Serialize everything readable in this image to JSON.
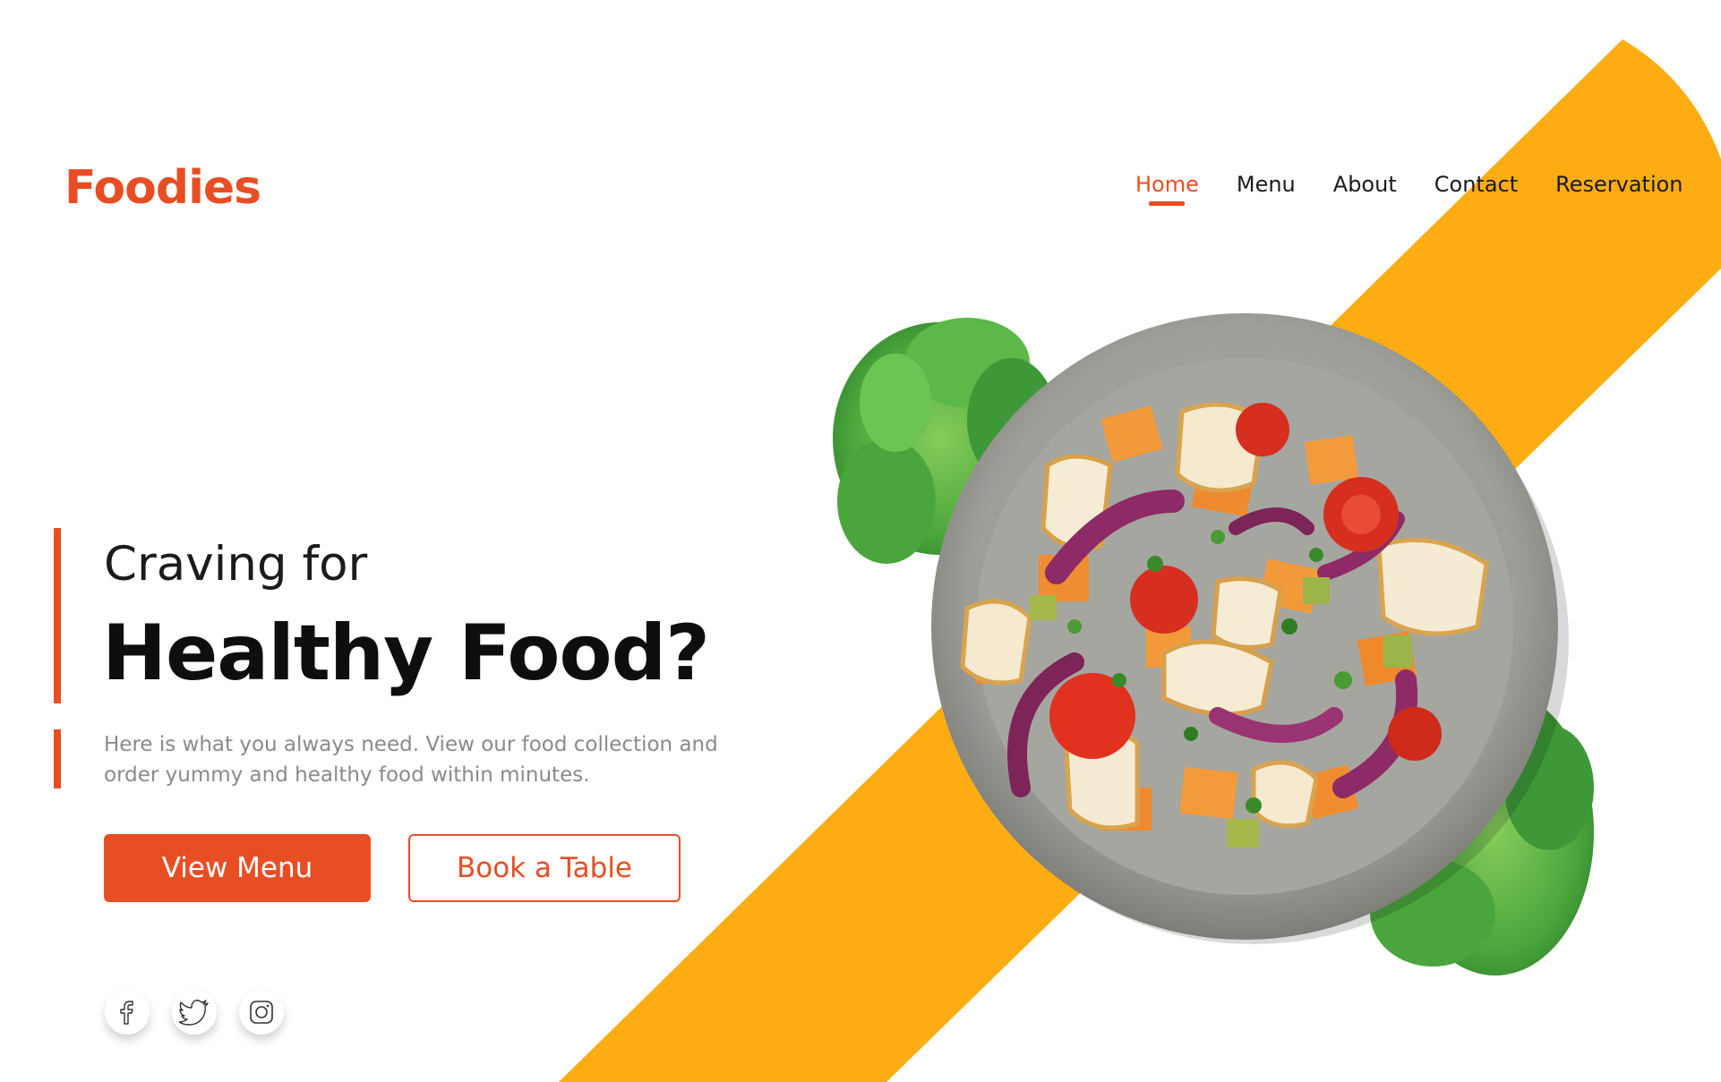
{
  "brand": {
    "name": "Foodies"
  },
  "nav": {
    "items": [
      {
        "label": "Home",
        "active": true
      },
      {
        "label": "Menu",
        "active": false
      },
      {
        "label": "About",
        "active": false
      },
      {
        "label": "Contact",
        "active": false
      },
      {
        "label": "Reservation",
        "active": false
      }
    ]
  },
  "hero": {
    "kicker": "Craving for",
    "headline": "Healthy Food?",
    "description": "Here is what you always need. View our food collection and order yummy and healthy food within minutes.",
    "primary_button": "View Menu",
    "secondary_button": "Book a Table"
  },
  "social": {
    "icons": [
      "facebook-icon",
      "twitter-icon",
      "instagram-icon"
    ]
  },
  "colors": {
    "brand": "#e84e24",
    "stripe": "#fdad13",
    "text_dark": "#0e0e0e",
    "text_muted": "#8a8a8a",
    "lettuce": "#4caf42",
    "plate": "#9a9a94"
  },
  "image": {
    "subject": "salad-bowl-with-lettuce"
  }
}
